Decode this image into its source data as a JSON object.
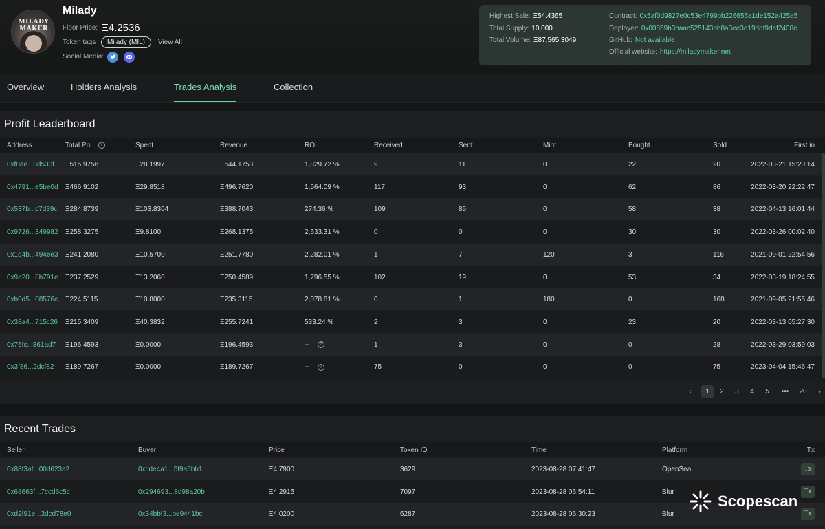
{
  "collection": {
    "name": "Milady",
    "avatar_caption": "MILADY MAKER",
    "floor_label": "Floor Price:",
    "floor_value": "Ξ4.2536",
    "tags_label": "Token tags",
    "tag": "Milady (MIL)",
    "view_all": "View All",
    "social_label": "Social Media:",
    "social_icons": [
      "twitter-icon",
      "discord-icon"
    ]
  },
  "info": {
    "highest_sale_label": "Highest Sale:",
    "highest_sale": "Ξ54.4365",
    "total_supply_label": "Total Supply:",
    "total_supply": "10,000",
    "total_volume_label": "Total Volume:",
    "total_volume": "Ξ87,565.3049",
    "contract_label": "Contract:",
    "contract": "0x5af0d9827e0c53e4799bb226655a1de152a425a5",
    "deployer_label": "Deployer:",
    "deployer": "0x00859b3baac525143bb8a3ee3e19ddf9daf2408c",
    "github_label": "GitHub:",
    "github": "Not available",
    "website_label": "Official website:",
    "website": "https://miladymaker.net"
  },
  "tabs": [
    {
      "label": "Overview"
    },
    {
      "label": "Holders Analysis"
    },
    {
      "label": "Trades Analysis",
      "active": true
    },
    {
      "label": "Collection"
    }
  ],
  "leaderboard": {
    "title": "Profit Leaderboard",
    "columns": [
      "Address",
      "Total PnL",
      "Spent",
      "Revenue",
      "ROI",
      "Received",
      "Sent",
      "Mint",
      "Bought",
      "Sold",
      "First in"
    ],
    "rows": [
      {
        "address": "0xf0ae...8d530f",
        "pnl": "Ξ515.9756",
        "spent": "Ξ28.1997",
        "revenue": "Ξ544.1753",
        "roi": "1,829.72 %",
        "received": "9",
        "sent": "11",
        "mint": "0",
        "bought": "22",
        "sold": "20",
        "first_in": "2022-03-21 15:20:14"
      },
      {
        "address": "0x4791...e5be0d",
        "pnl": "Ξ466.9102",
        "spent": "Ξ29.8518",
        "revenue": "Ξ496.7620",
        "roi": "1,564.09 %",
        "received": "117",
        "sent": "93",
        "mint": "0",
        "bought": "62",
        "sold": "86",
        "first_in": "2022-03-20 22:22:47"
      },
      {
        "address": "0x537b...c7d39c",
        "pnl": "Ξ284.8739",
        "spent": "Ξ103.8304",
        "revenue": "Ξ388.7043",
        "roi": "274.36 %",
        "received": "109",
        "sent": "85",
        "mint": "0",
        "bought": "58",
        "sold": "38",
        "first_in": "2022-04-13 16:01:44"
      },
      {
        "address": "0x9726...349982",
        "pnl": "Ξ258.3275",
        "spent": "Ξ9.8100",
        "revenue": "Ξ268.1375",
        "roi": "2,633.31 %",
        "received": "0",
        "sent": "0",
        "mint": "0",
        "bought": "30",
        "sold": "30",
        "first_in": "2022-03-26 00:02:40"
      },
      {
        "address": "0x1d4b...494ee3",
        "pnl": "Ξ241.2080",
        "spent": "Ξ10.5700",
        "revenue": "Ξ251.7780",
        "roi": "2,282.01 %",
        "received": "1",
        "sent": "7",
        "mint": "120",
        "bought": "3",
        "sold": "116",
        "first_in": "2021-09-01 22:54:56"
      },
      {
        "address": "0x9a20...8b791e",
        "pnl": "Ξ237.2529",
        "spent": "Ξ13.2060",
        "revenue": "Ξ250.4589",
        "roi": "1,796.55 %",
        "received": "102",
        "sent": "19",
        "mint": "0",
        "bought": "53",
        "sold": "34",
        "first_in": "2022-03-19 18:24:55"
      },
      {
        "address": "0xb0d5...08576c",
        "pnl": "Ξ224.5115",
        "spent": "Ξ10.8000",
        "revenue": "Ξ235.3115",
        "roi": "2,078.81 %",
        "received": "0",
        "sent": "1",
        "mint": "180",
        "bought": "0",
        "sold": "168",
        "first_in": "2021-09-05 21:55:46"
      },
      {
        "address": "0x38a4...715c26",
        "pnl": "Ξ215.3409",
        "spent": "Ξ40.3832",
        "revenue": "Ξ255.7241",
        "roi": "533.24 %",
        "received": "2",
        "sent": "3",
        "mint": "0",
        "bought": "23",
        "sold": "20",
        "first_in": "2022-03-13 05:27:30"
      },
      {
        "address": "0x76fc...861ad7",
        "pnl": "Ξ196.4593",
        "spent": "Ξ0.0000",
        "revenue": "Ξ196.4593",
        "roi": "--",
        "roi_help": true,
        "received": "1",
        "sent": "3",
        "mint": "0",
        "bought": "0",
        "sold": "28",
        "first_in": "2022-03-29 03:59:03"
      },
      {
        "address": "0x3f86...2dcf82",
        "pnl": "Ξ189.7267",
        "spent": "Ξ0.0000",
        "revenue": "Ξ189.7267",
        "roi": "--",
        "roi_help": true,
        "received": "75",
        "sent": "0",
        "mint": "0",
        "bought": "0",
        "sold": "75",
        "first_in": "2023-04-04 15:46:47"
      }
    ],
    "pagination": {
      "prev": "‹",
      "pages": [
        "1",
        "2",
        "3",
        "4",
        "5"
      ],
      "ellipsis": "•••",
      "last": "20",
      "next": "›",
      "current": "1"
    }
  },
  "recent": {
    "title": "Recent Trades",
    "columns": [
      "Seller",
      "Buyer",
      "Price",
      "Token ID",
      "Time",
      "Platform",
      "Tx"
    ],
    "rows": [
      {
        "seller": "0x88f3af...00d623a2",
        "buyer": "0xcde4a1...5f9a5bb1",
        "price": "Ξ4.7900",
        "token_id": "3629",
        "time": "2023-08-28 07:41:47",
        "platform": "OpenSea",
        "tx": "Tx"
      },
      {
        "seller": "0x68663f...7ccd6c5c",
        "buyer": "0x294693...8d98a20b",
        "price": "Ξ4.2915",
        "token_id": "7097",
        "time": "2023-08-28 06:54:11",
        "platform": "Blur",
        "tx": "Tx"
      },
      {
        "seller": "0xd2f91e...3dcd78e0",
        "buyer": "0x34bbf3...be9441bc",
        "price": "Ξ4.0200",
        "token_id": "6287",
        "time": "2023-08-28 06:30:23",
        "platform": "Blur",
        "tx": "Tx"
      }
    ]
  },
  "brand": {
    "name": "Scopescan",
    "icon": "scopescan-logo-icon"
  },
  "colors": {
    "accent": "#5fd6a6",
    "background": "#141516",
    "panel": "#2c3733"
  }
}
